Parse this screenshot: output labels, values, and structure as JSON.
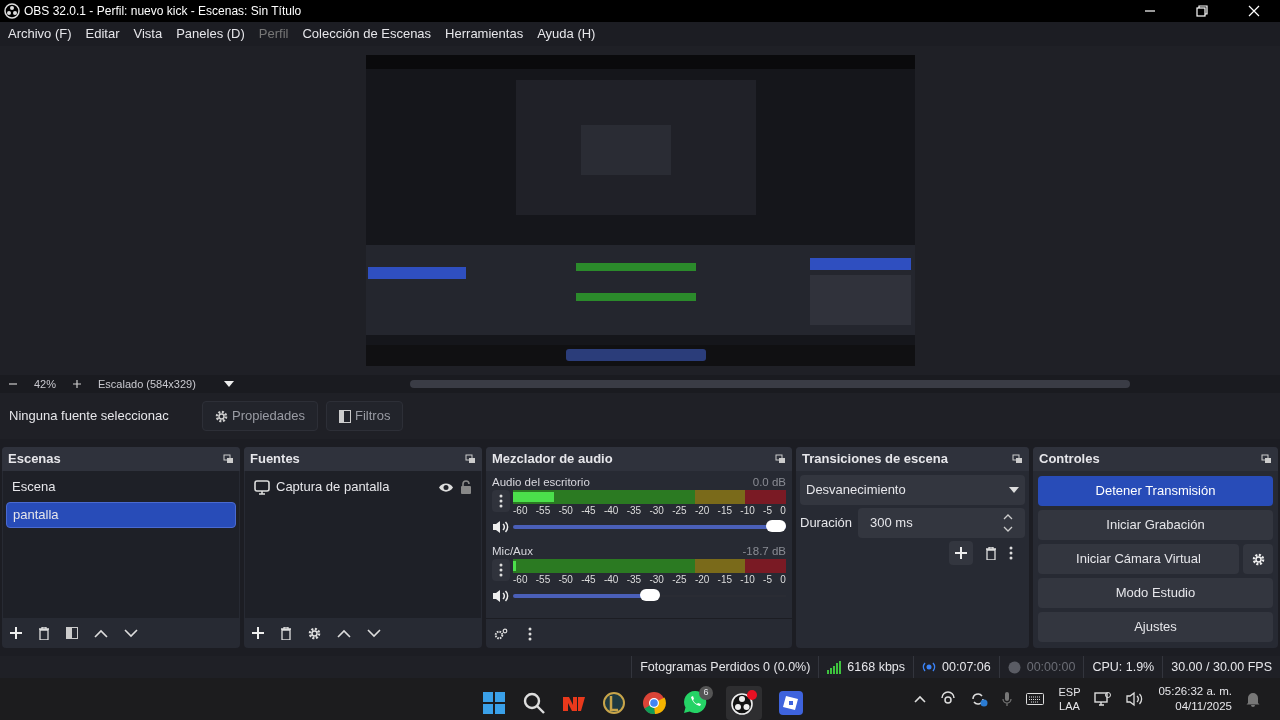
{
  "window": {
    "title": "OBS 32.0.1 - Perfil: nuevo kick - Escenas: Sin Título"
  },
  "menu": [
    {
      "label": "Archivo (F)",
      "disabled": false
    },
    {
      "label": "Editar",
      "disabled": false
    },
    {
      "label": "Vista",
      "disabled": false
    },
    {
      "label": "Paneles (D)",
      "disabled": false
    },
    {
      "label": "Perfil",
      "disabled": true
    },
    {
      "label": "Colección de Escenas",
      "disabled": false
    },
    {
      "label": "Herramientas",
      "disabled": false
    },
    {
      "label": "Ayuda (H)",
      "disabled": false
    }
  ],
  "zoom_bar": {
    "zoom": "42%",
    "scaling": "Escalado (584x329)"
  },
  "source_toolbar": {
    "label": "Ninguna fuente seleccionac",
    "buttons": [
      {
        "kind": "properties",
        "label": "Propiedades"
      },
      {
        "kind": "filters",
        "label": "Filtros"
      }
    ]
  },
  "scenes": {
    "title": "Escenas",
    "items": [
      {
        "label": "Escena",
        "selected": false
      },
      {
        "label": "pantalla",
        "selected": true
      }
    ]
  },
  "sources": {
    "title": "Fuentes",
    "items": [
      {
        "label": "Captura de pantalla"
      }
    ]
  },
  "mixer": {
    "title": "Mezclador de audio",
    "channels": [
      {
        "name": "Audio del escritorio",
        "reading": "0.0 dB",
        "meter": {
          "level": 0.15
        },
        "volume": {
          "level": 1.0
        },
        "scale": [
          "-60",
          "-55",
          "-50",
          "-45",
          "-40",
          "-35",
          "-30",
          "-25",
          "-20",
          "-15",
          "-10",
          "-5",
          "0"
        ]
      },
      {
        "name": "Mic/Aux",
        "reading": "-18.7 dB",
        "meter": {
          "level": 0.01
        },
        "volume": {
          "level": 0.5
        },
        "scale": [
          "-60",
          "-55",
          "-50",
          "-45",
          "-40",
          "-35",
          "-30",
          "-25",
          "-20",
          "-15",
          "-10",
          "-5",
          "0"
        ]
      }
    ]
  },
  "transitions": {
    "title": "Transiciones de escena",
    "transition": "Desvanecimiento",
    "duration_label": "Duración",
    "duration": "300 ms"
  },
  "controls": {
    "title": "Controles",
    "buttons": [
      {
        "label": "Detener Transmisión",
        "active": true,
        "kind": "plain"
      },
      {
        "label": "Iniciar Grabación",
        "active": false,
        "kind": "plain"
      },
      {
        "label": "Iniciar Cámara Virtual",
        "active": false,
        "kind": "with_settings"
      },
      {
        "label": "Modo Estudio",
        "active": false,
        "kind": "plain"
      },
      {
        "label": "Ajustes",
        "active": false,
        "kind": "plain"
      }
    ]
  },
  "status_bar": {
    "dropped": "Fotogramas Perdidos 0 (0.0%)",
    "bitrate": "6168 kbps",
    "stream_time": "00:07:06",
    "record_time": "00:00:00",
    "cpu": "CPU: 1.9%",
    "fps": "30.00 / 30.00 FPS"
  },
  "taskbar": {
    "whatsapp_badge": "6",
    "language": "ESP",
    "layout": "LAA",
    "time": "05:26:32 a. m.",
    "date": "04/11/2025"
  }
}
